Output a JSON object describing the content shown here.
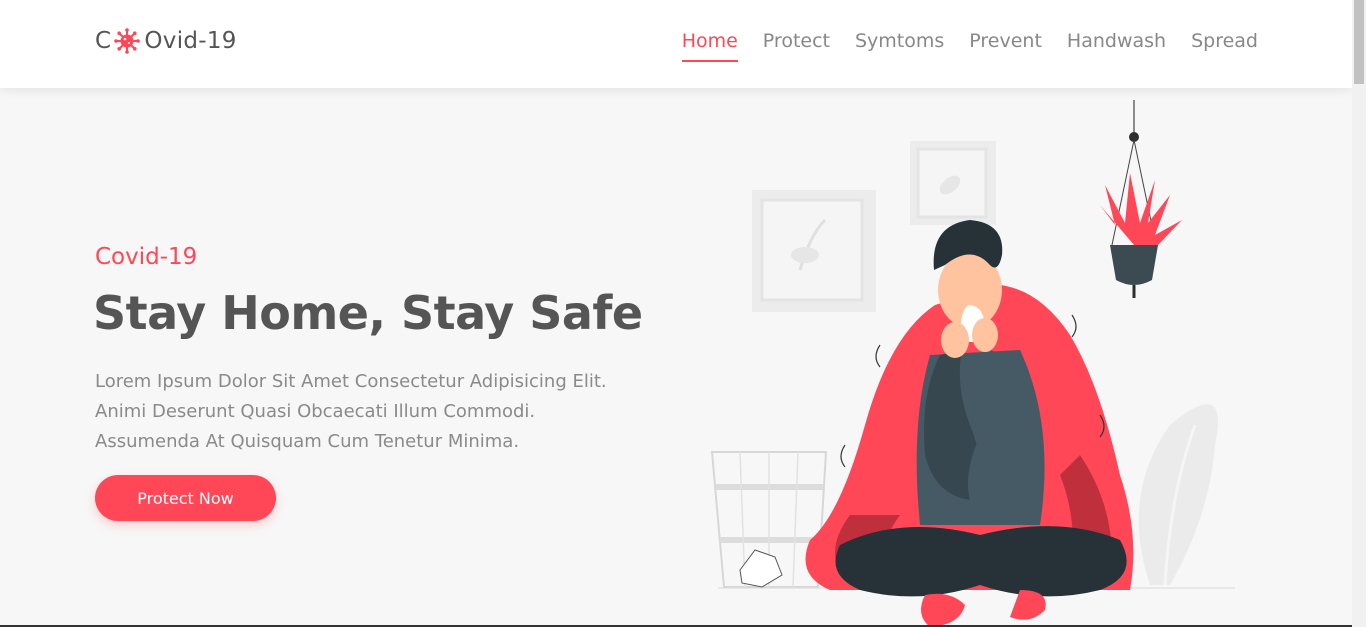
{
  "brand": {
    "logo_prefix": "C",
    "logo_suffix": "Ovid-19",
    "accent_color": "#ff4757"
  },
  "nav": {
    "items": [
      {
        "label": "Home",
        "active": true
      },
      {
        "label": "Protect",
        "active": false
      },
      {
        "label": "Symtoms",
        "active": false
      },
      {
        "label": "Prevent",
        "active": false
      },
      {
        "label": "Handwash",
        "active": false
      },
      {
        "label": "Spread",
        "active": false
      }
    ]
  },
  "hero": {
    "subtitle": "Covid-19",
    "title": "Stay Home, Stay Safe",
    "text_line_1": "Lorem Ipsum Dolor Sit Amet Consectetur Adipisicing Elit.",
    "text_line_2": "Animi Deserunt Quasi Obcaecati Illum Commodi.",
    "text_line_3": "Assumenda At Quisquam Cum Tenetur Minima.",
    "button_label": "Protect Now"
  },
  "icons": {
    "logo": "virus-icon"
  }
}
